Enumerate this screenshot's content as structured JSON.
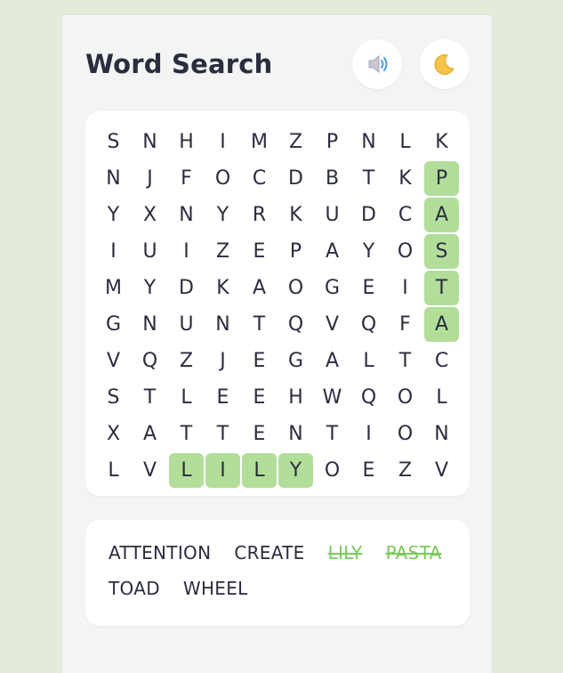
{
  "header": {
    "title": "Word Search"
  },
  "controls": {
    "sound_icon": "speaker-icon",
    "theme_icon": "crescent-moon-icon"
  },
  "grid": {
    "rows": [
      [
        "S",
        "N",
        "H",
        "I",
        "M",
        "Z",
        "P",
        "N",
        "L",
        "K"
      ],
      [
        "N",
        "J",
        "F",
        "O",
        "C",
        "D",
        "B",
        "T",
        "K",
        "P"
      ],
      [
        "Y",
        "X",
        "N",
        "Y",
        "R",
        "K",
        "U",
        "D",
        "C",
        "A"
      ],
      [
        "I",
        "U",
        "I",
        "Z",
        "E",
        "P",
        "A",
        "Y",
        "O",
        "S"
      ],
      [
        "M",
        "Y",
        "D",
        "K",
        "A",
        "O",
        "G",
        "E",
        "I",
        "T"
      ],
      [
        "G",
        "N",
        "U",
        "N",
        "T",
        "Q",
        "V",
        "Q",
        "F",
        "A"
      ],
      [
        "V",
        "Q",
        "Z",
        "J",
        "E",
        "G",
        "A",
        "L",
        "T",
        "C"
      ],
      [
        "S",
        "T",
        "L",
        "E",
        "E",
        "H",
        "W",
        "Q",
        "O",
        "L"
      ],
      [
        "X",
        "A",
        "T",
        "T",
        "E",
        "N",
        "T",
        "I",
        "O",
        "N"
      ],
      [
        "L",
        "V",
        "L",
        "I",
        "L",
        "Y",
        "O",
        "E",
        "Z",
        "V"
      ]
    ],
    "found_cells": [
      [
        1,
        9
      ],
      [
        2,
        9
      ],
      [
        3,
        9
      ],
      [
        4,
        9
      ],
      [
        5,
        9
      ],
      [
        9,
        2
      ],
      [
        9,
        3
      ],
      [
        9,
        4
      ],
      [
        9,
        5
      ]
    ]
  },
  "word_list": [
    {
      "text": "ATTENTION",
      "found": false
    },
    {
      "text": "CREATE",
      "found": false
    },
    {
      "text": "LILY",
      "found": true
    },
    {
      "text": "PASTA",
      "found": true
    },
    {
      "text": "TOAD",
      "found": false
    },
    {
      "text": "WHEEL",
      "found": false
    }
  ],
  "colors": {
    "background": "#e3ebda",
    "found_highlight": "#b2de9a",
    "found_word": "#7ac95c",
    "text": "#2b2d3e"
  }
}
